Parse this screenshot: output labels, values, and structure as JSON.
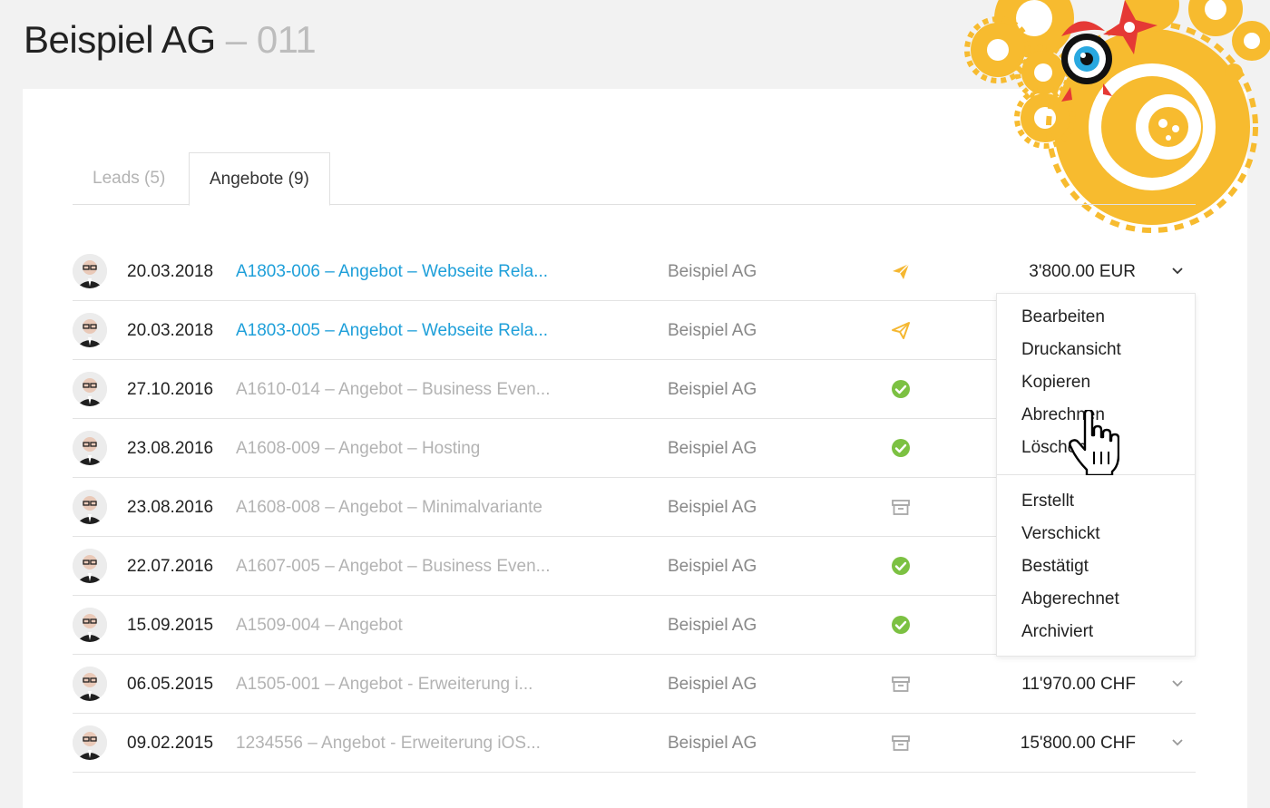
{
  "header": {
    "company": "Beispiel AG",
    "separator": " – ",
    "code": "011"
  },
  "tabs": [
    {
      "label": "Leads (5)",
      "active": false
    },
    {
      "label": "Angebote (9)",
      "active": true
    }
  ],
  "rows": [
    {
      "date": "20.03.2018",
      "title": "A1803-006 – Angebot – Webseite Rela...",
      "company": "Beispiel AG",
      "status": "sent-icon",
      "amount": "3'800.00 EUR",
      "active": true
    },
    {
      "date": "20.03.2018",
      "title": "A1803-005 – Angebot – Webseite Rela...",
      "company": "Beispiel AG",
      "status": "sent-outline-icon",
      "amount": "",
      "active": true
    },
    {
      "date": "27.10.2016",
      "title": "A1610-014 – Angebot – Business Even...",
      "company": "Beispiel AG",
      "status": "check-icon",
      "amount": "",
      "active": false
    },
    {
      "date": "23.08.2016",
      "title": "A1608-009 – Angebot – Hosting",
      "company": "Beispiel AG",
      "status": "check-icon",
      "amount": "",
      "active": false
    },
    {
      "date": "23.08.2016",
      "title": "A1608-008 – Angebot – Minimalvariante",
      "company": "Beispiel AG",
      "status": "archive-icon",
      "amount": "",
      "active": false
    },
    {
      "date": "22.07.2016",
      "title": "A1607-005 – Angebot – Business Even...",
      "company": "Beispiel AG",
      "status": "check-icon",
      "amount": "",
      "active": false
    },
    {
      "date": "15.09.2015",
      "title": "A1509-004 – Angebot",
      "company": "Beispiel AG",
      "status": "check-icon",
      "amount": "",
      "active": false
    },
    {
      "date": "06.05.2015",
      "title": "A1505-001 – Angebot - Erweiterung i...",
      "company": "Beispiel AG",
      "status": "archive-icon",
      "amount": "11'970.00 CHF",
      "active": false
    },
    {
      "date": "09.02.2015",
      "title": "1234556 – Angebot - Erweiterung iOS...",
      "company": "Beispiel AG",
      "status": "archive-icon",
      "amount": "15'800.00 CHF",
      "active": false
    }
  ],
  "dropdown": {
    "actions": [
      "Bearbeiten",
      "Druckansicht",
      "Kopieren",
      "Abrechnen",
      "Löschen"
    ],
    "statuses": [
      "Erstellt",
      "Verschickt",
      "Bestätigt",
      "Abgerechnet",
      "Archiviert"
    ]
  },
  "colors": {
    "link": "#1e9fd9",
    "sent": "#f5b731",
    "check": "#7cc142",
    "archive": "#a8a8a8",
    "muted": "#b3b3b3"
  }
}
